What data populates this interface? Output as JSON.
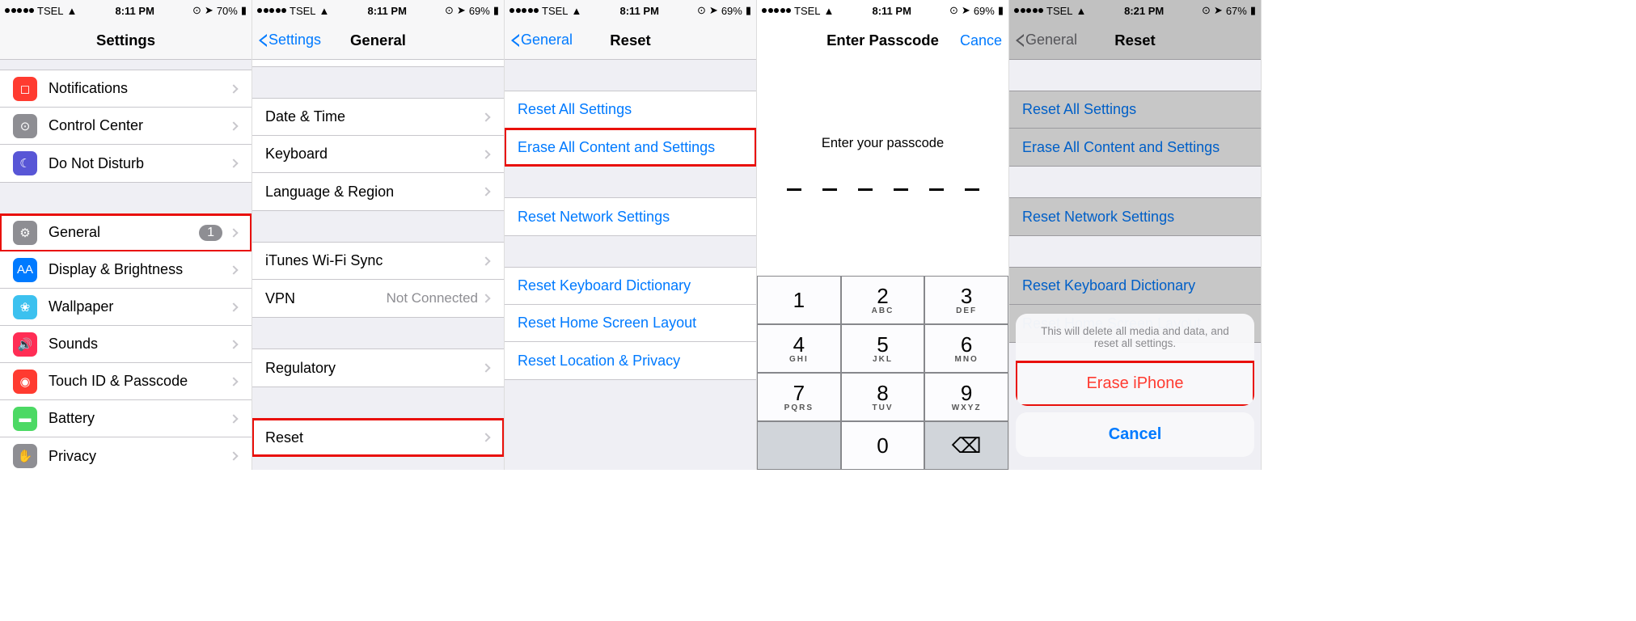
{
  "carrier": "TSEL",
  "screens": [
    {
      "time": "8:11 PM",
      "battery": "70%",
      "title": "Settings",
      "back": null,
      "items": [
        {
          "icon": "#ff3b30",
          "glyph": "◻",
          "label": "Notifications"
        },
        {
          "icon": "#8e8e93",
          "glyph": "⊙",
          "label": "Control Center"
        },
        {
          "icon": "#5856d6",
          "glyph": "☾",
          "label": "Do Not Disturb"
        }
      ],
      "items2": [
        {
          "icon": "#8e8e93",
          "glyph": "⚙",
          "label": "General",
          "badge": "1",
          "highlight": true
        },
        {
          "icon": "#007aff",
          "glyph": "AA",
          "label": "Display & Brightness"
        },
        {
          "icon": "#3cc1ef",
          "glyph": "❀",
          "label": "Wallpaper"
        },
        {
          "icon": "#ff2d55",
          "glyph": "🔊",
          "label": "Sounds"
        },
        {
          "icon": "#ff3b30",
          "glyph": "◉",
          "label": "Touch ID & Passcode"
        },
        {
          "icon": "#4cd964",
          "glyph": "▬",
          "label": "Battery"
        },
        {
          "icon": "#8e8e93",
          "glyph": "✋",
          "label": "Privacy"
        }
      ]
    },
    {
      "time": "8:11 PM",
      "battery": "69%",
      "title": "General",
      "back": "Settings",
      "itemsA": [
        {
          "label": "Date & Time"
        },
        {
          "label": "Keyboard"
        },
        {
          "label": "Language & Region"
        }
      ],
      "itemsB": [
        {
          "label": "iTunes Wi-Fi Sync"
        },
        {
          "label": "VPN",
          "value": "Not Connected"
        }
      ],
      "itemsC": [
        {
          "label": "Regulatory"
        }
      ],
      "itemsD": [
        {
          "label": "Reset",
          "highlight": true
        }
      ]
    },
    {
      "time": "8:11 PM",
      "battery": "69%",
      "title": "Reset",
      "back": "General",
      "g1": [
        {
          "label": "Reset All Settings"
        },
        {
          "label": "Erase All Content and Settings",
          "highlight": true
        }
      ],
      "g2": [
        {
          "label": "Reset Network Settings"
        }
      ],
      "g3": [
        {
          "label": "Reset Keyboard Dictionary"
        },
        {
          "label": "Reset Home Screen Layout"
        },
        {
          "label": "Reset Location & Privacy"
        }
      ]
    },
    {
      "time": "8:11 PM",
      "battery": "69%",
      "title": "Enter Passcode",
      "cancel": "Cance",
      "prompt": "Enter your passcode",
      "keys": [
        {
          "n": "1",
          "l": ""
        },
        {
          "n": "2",
          "l": "ABC"
        },
        {
          "n": "3",
          "l": "DEF"
        },
        {
          "n": "4",
          "l": "GHI"
        },
        {
          "n": "5",
          "l": "JKL"
        },
        {
          "n": "6",
          "l": "MNO"
        },
        {
          "n": "7",
          "l": "PQRS"
        },
        {
          "n": "8",
          "l": "TUV"
        },
        {
          "n": "9",
          "l": "WXYZ"
        },
        {
          "blank": true
        },
        {
          "n": "0",
          "l": ""
        },
        {
          "del": true
        }
      ]
    },
    {
      "time": "8:21 PM",
      "battery": "67%",
      "title": "Reset",
      "back": "General",
      "g1": [
        {
          "label": "Reset All Settings"
        },
        {
          "label": "Erase All Content and Settings"
        }
      ],
      "g2": [
        {
          "label": "Reset Network Settings"
        }
      ],
      "g3": [
        {
          "label": "Reset Keyboard Dictionary"
        },
        {
          "label": "Reset Home Screen Layout"
        }
      ],
      "sheet_msg": "This will delete all media and data, and reset all settings.",
      "sheet_erase": "Erase iPhone",
      "sheet_cancel": "Cancel"
    }
  ]
}
